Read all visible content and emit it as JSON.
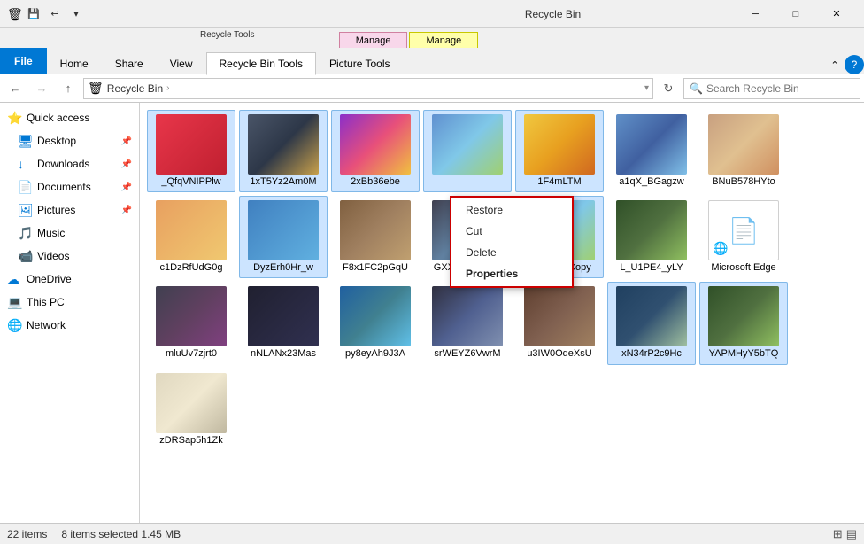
{
  "titleBar": {
    "title": "Recycle Bin",
    "qatButtons": [
      "save",
      "undo",
      "customize"
    ],
    "windowControls": [
      "minimize",
      "maximize",
      "close"
    ]
  },
  "ribbon": {
    "toolsLabel": "Recycle Tools",
    "manageTabs": [
      {
        "label": "Manage",
        "style": "pink"
      },
      {
        "label": "Manage",
        "style": "yellow"
      }
    ],
    "mainTabs": [
      {
        "label": "File",
        "style": "file"
      },
      {
        "label": "Home",
        "active": false
      },
      {
        "label": "Share",
        "active": false
      },
      {
        "label": "View",
        "active": false
      },
      {
        "label": "Recycle Bin Tools",
        "active": true
      },
      {
        "label": "Picture Tools",
        "active": false
      }
    ]
  },
  "addressBar": {
    "backDisabled": false,
    "forwardDisabled": true,
    "upLabel": "↑",
    "pathIcon": "🗑",
    "pathParts": [
      "Recycle Bin",
      ">"
    ],
    "searchPlaceholder": "Search Recycle Bin"
  },
  "sidebar": {
    "items": [
      {
        "id": "quick-access",
        "label": "Quick access",
        "icon": "⭐",
        "starred": true,
        "indent": 0
      },
      {
        "id": "desktop",
        "label": "Desktop",
        "icon": "🖥",
        "pinned": true,
        "indent": 1
      },
      {
        "id": "downloads",
        "label": "Downloads",
        "icon": "📥",
        "pinned": true,
        "indent": 1
      },
      {
        "id": "documents",
        "label": "Documents",
        "icon": "📄",
        "pinned": true,
        "indent": 1
      },
      {
        "id": "pictures",
        "label": "Pictures",
        "icon": "🖼",
        "pinned": true,
        "indent": 1
      },
      {
        "id": "music",
        "label": "Music",
        "icon": "🎵",
        "indent": 1
      },
      {
        "id": "videos",
        "label": "Videos",
        "icon": "📹",
        "indent": 1
      },
      {
        "id": "onedrive",
        "label": "OneDrive",
        "icon": "☁",
        "indent": 0
      },
      {
        "id": "this-pc",
        "label": "This PC",
        "icon": "💻",
        "indent": 0
      },
      {
        "id": "network",
        "label": "Network",
        "icon": "🌐",
        "indent": 0
      }
    ]
  },
  "contextMenu": {
    "items": [
      {
        "label": "Restore",
        "bold": false,
        "divider": false
      },
      {
        "label": "Cut",
        "bold": false,
        "divider": false
      },
      {
        "label": "Delete",
        "bold": false,
        "divider": false
      },
      {
        "label": "Properties",
        "bold": true,
        "divider": false
      }
    ]
  },
  "files": [
    {
      "id": 1,
      "name": "_QfqVNIPPlw",
      "thumb": "thumb-1",
      "selected": true,
      "hasOverlay": false
    },
    {
      "id": 2,
      "name": "1xT5Yz2Am0M",
      "thumb": "thumb-2",
      "selected": true,
      "hasOverlay": false
    },
    {
      "id": 3,
      "name": "2xBb36ebe",
      "thumb": "thumb-3",
      "selected": true,
      "hasOverlay": false
    },
    {
      "id": 4,
      "name": "",
      "thumb": "thumb-4",
      "selected": true,
      "hasOverlay": false
    },
    {
      "id": 5,
      "name": "1F4mLTM",
      "thumb": "thumb-5",
      "selected": true,
      "hasOverlay": false
    },
    {
      "id": 6,
      "name": "a1qX_BGagzw",
      "thumb": "thumb-6",
      "selected": false,
      "hasOverlay": false
    },
    {
      "id": 7,
      "name": "BNuB578HYto",
      "thumb": "thumb-7",
      "selected": false,
      "hasOverlay": false
    },
    {
      "id": 8,
      "name": "c1DzRfUdG0g",
      "thumb": "thumb-8",
      "selected": false,
      "hasOverlay": false
    },
    {
      "id": 9,
      "name": "DyzErh0Hr_w",
      "thumb": "thumb-10",
      "selected": true,
      "hasOverlay": false
    },
    {
      "id": 10,
      "name": "F8x1FC2pGqU",
      "thumb": "thumb-13",
      "selected": false,
      "hasOverlay": false
    },
    {
      "id": 11,
      "name": "GXXaRyf0Ymw",
      "thumb": "thumb-14",
      "selected": false,
      "hasOverlay": false
    },
    {
      "id": 12,
      "name": "Images - Copy",
      "thumb": "thumb-4",
      "selected": true,
      "hasOverlay": false
    },
    {
      "id": 13,
      "name": "L_U1PE4_yLY",
      "thumb": "thumb-21",
      "selected": false,
      "hasOverlay": false
    },
    {
      "id": 14,
      "name": "Microsoft Edge",
      "thumb": "thumb-doc",
      "selected": false,
      "hasOverlay": true,
      "overlayIcon": "🌐"
    },
    {
      "id": 15,
      "name": "mluUv7zjrt0",
      "thumb": "thumb-16",
      "selected": false,
      "hasOverlay": false
    },
    {
      "id": 16,
      "name": "nNLANx23Mas",
      "thumb": "thumb-17",
      "selected": false,
      "hasOverlay": false
    },
    {
      "id": 17,
      "name": "py8eyAh9J3A",
      "thumb": "thumb-9",
      "selected": false,
      "hasOverlay": false
    },
    {
      "id": 18,
      "name": "srWEYZ6VwrM",
      "thumb": "thumb-11",
      "selected": false,
      "hasOverlay": false
    },
    {
      "id": 19,
      "name": "u3IW0OqeXsU",
      "thumb": "thumb-15",
      "selected": false,
      "hasOverlay": false
    },
    {
      "id": 20,
      "name": "xN34rP2c9Hc",
      "thumb": "thumb-20",
      "selected": true,
      "hasOverlay": false
    },
    {
      "id": 21,
      "name": "YAPMHyY5bTQ",
      "thumb": "thumb-21",
      "selected": true,
      "hasOverlay": false
    },
    {
      "id": 22,
      "name": "zDRSap5h1Zk",
      "thumb": "thumb-22",
      "selected": false,
      "hasOverlay": false
    }
  ],
  "statusBar": {
    "totalItems": "22 items",
    "selectedItems": "8 items selected",
    "selectedSize": "1.45 MB"
  }
}
